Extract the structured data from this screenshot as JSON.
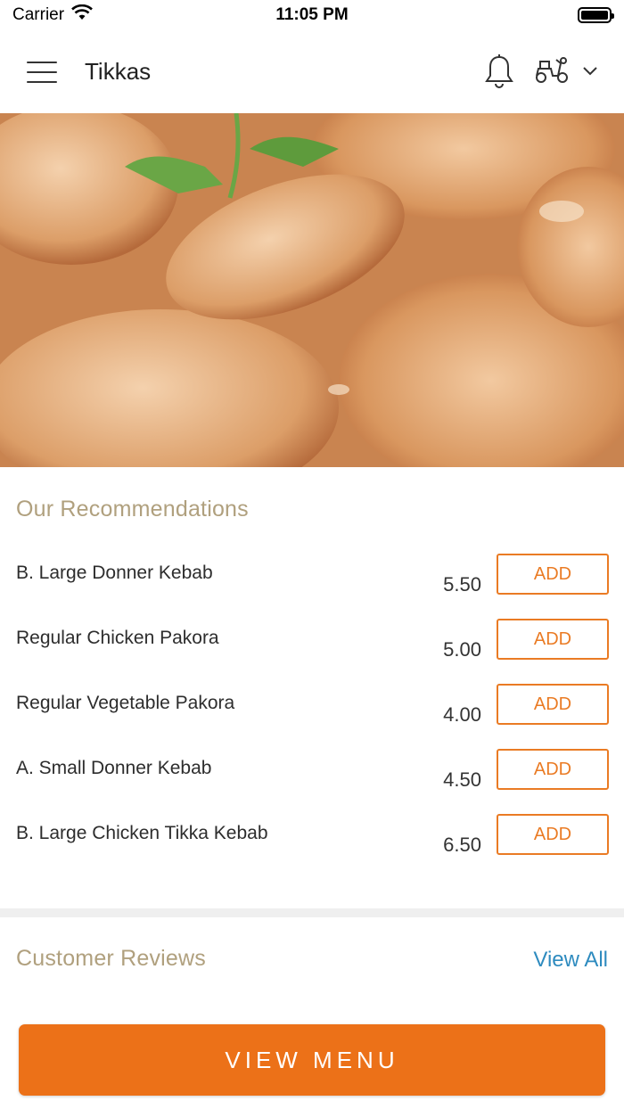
{
  "status_bar": {
    "carrier": "Carrier",
    "time": "11:05 PM"
  },
  "header": {
    "title": "Tikkas"
  },
  "recommendations": {
    "title": "Our Recommendations",
    "add_label": "ADD",
    "items": [
      {
        "name": "B. Large Donner Kebab",
        "price": "5.50"
      },
      {
        "name": "Regular Chicken Pakora",
        "price": "5.00"
      },
      {
        "name": "Regular Vegetable Pakora",
        "price": "4.00"
      },
      {
        "name": "A. Small Donner Kebab",
        "price": "4.50"
      },
      {
        "name": "B. Large Chicken Tikka Kebab",
        "price": "6.50"
      }
    ]
  },
  "reviews": {
    "title": "Customer Reviews",
    "view_all": "View All"
  },
  "footer": {
    "view_menu": "VIEW MENU"
  },
  "colors": {
    "accent": "#ec7118",
    "section_title": "#b0a07e",
    "link": "#2e8bbf"
  },
  "icons": [
    "wifi-icon",
    "battery-icon",
    "hamburger-menu-icon",
    "bell-icon",
    "scooter-icon",
    "chevron-down-icon"
  ]
}
